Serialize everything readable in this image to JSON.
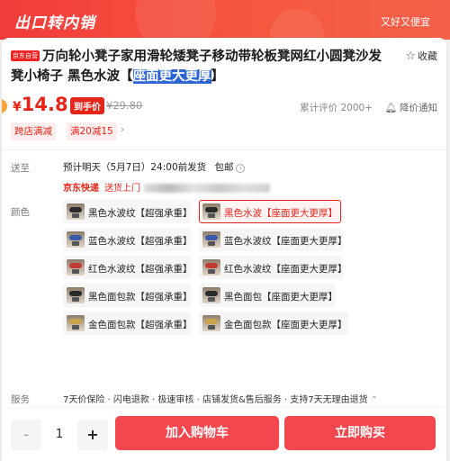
{
  "banner": {
    "title": "出口转内销",
    "right_text": "又好又便宜"
  },
  "product": {
    "badge": "京东自营",
    "title_main": "万向轮小凳子家用滑轮矮凳子移动带轮板凳网红小圆凳沙发凳小椅子 黑色水波【",
    "title_highlight": "座面更大更厚",
    "title_end": "】",
    "favorite_label": "收藏",
    "favorite_icon": "star-outline-icon"
  },
  "price": {
    "currency": "¥",
    "current": "14.8",
    "tag": "到手价",
    "original": "¥29.80",
    "reviews": "累计评价 2000+",
    "notify_label": "降价通知",
    "accent_color": "#e4261a"
  },
  "promo_tags": [
    "跨店满减",
    "满20减15"
  ],
  "shipping": {
    "label": "送至",
    "estimate": "预计明天（5月7日）24:00前发货",
    "postage": "包邮",
    "express": "京东快递",
    "door": "送货上门"
  },
  "colors": {
    "label": "颜色",
    "options": [
      {
        "label": "黑色水波纹【超强承重】",
        "selected": false,
        "seat": "#2a2a2a"
      },
      {
        "label": "黑色水波【座面更大更厚】",
        "selected": true,
        "seat": "#2a2a2a"
      },
      {
        "label": "蓝色水波纹【超强承重】",
        "selected": false,
        "seat": "#3c5aa8"
      },
      {
        "label": "蓝色水波纹【座面更大更厚】",
        "selected": false,
        "seat": "#3c5aa8"
      },
      {
        "label": "红色水波纹【超强承重】",
        "selected": false,
        "seat": "#c23a34"
      },
      {
        "label": "红色水波纹【座面更大更厚】",
        "selected": false,
        "seat": "#c23a34"
      },
      {
        "label": "黑色面包款【超强承重】",
        "selected": false,
        "seat": "#2a2a2a"
      },
      {
        "label": "黑色面包【座面更大更厚】",
        "selected": false,
        "seat": "#2a2a2a"
      },
      {
        "label": "金色面包款【超强承重】",
        "selected": false,
        "seat": "#c9a24a"
      },
      {
        "label": "金色面包款【座面更大更厚】",
        "selected": false,
        "seat": "#c9a24a"
      }
    ]
  },
  "service": {
    "label": "服务",
    "text": "7天价保险 · 闪电退款 · 极速审核 · 店铺发货&售后服务 · 支持7天无理由退货"
  },
  "purchase": {
    "quantity": "1",
    "minus": "-",
    "plus": "+",
    "add_to_cart": "加入购物车",
    "buy_now": "立即购买"
  }
}
